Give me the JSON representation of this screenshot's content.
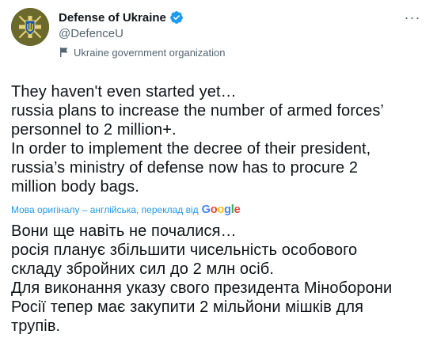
{
  "account": {
    "name": "Defense of Ukraine",
    "handle": "@DefenceU",
    "label": "Ukraine government organization",
    "avatar_color": "#6b6a2c",
    "verified_color": "#1d9bf0"
  },
  "icons": {
    "verified": "verified-badge-icon",
    "government": "flag-icon",
    "more": "more-horizontal-icon"
  },
  "more_label": "···",
  "tweet": {
    "original_lines": [
      "They haven't even started yet…",
      "russia plans to increase the number of armed forces’",
      "personnel to 2 million+.",
      "In order to implement the decree of their president,",
      "russia’s ministry of defense now has to procure 2",
      "million body bags."
    ],
    "translation_note": "Мова оригіналу – англійська, переклад від",
    "translation_provider": [
      "G",
      "o",
      "o",
      "g",
      "l",
      "e"
    ],
    "translated_lines": [
      "Вони ще навіть не почалися…",
      "росія планує збільшити чисельність особового",
      "складу збройних сил до 2 млн осіб.",
      "Для виконання указу свого президента Міноборони",
      "Росії тепер має закупити 2 мільйони мішків для",
      "трупів."
    ]
  }
}
